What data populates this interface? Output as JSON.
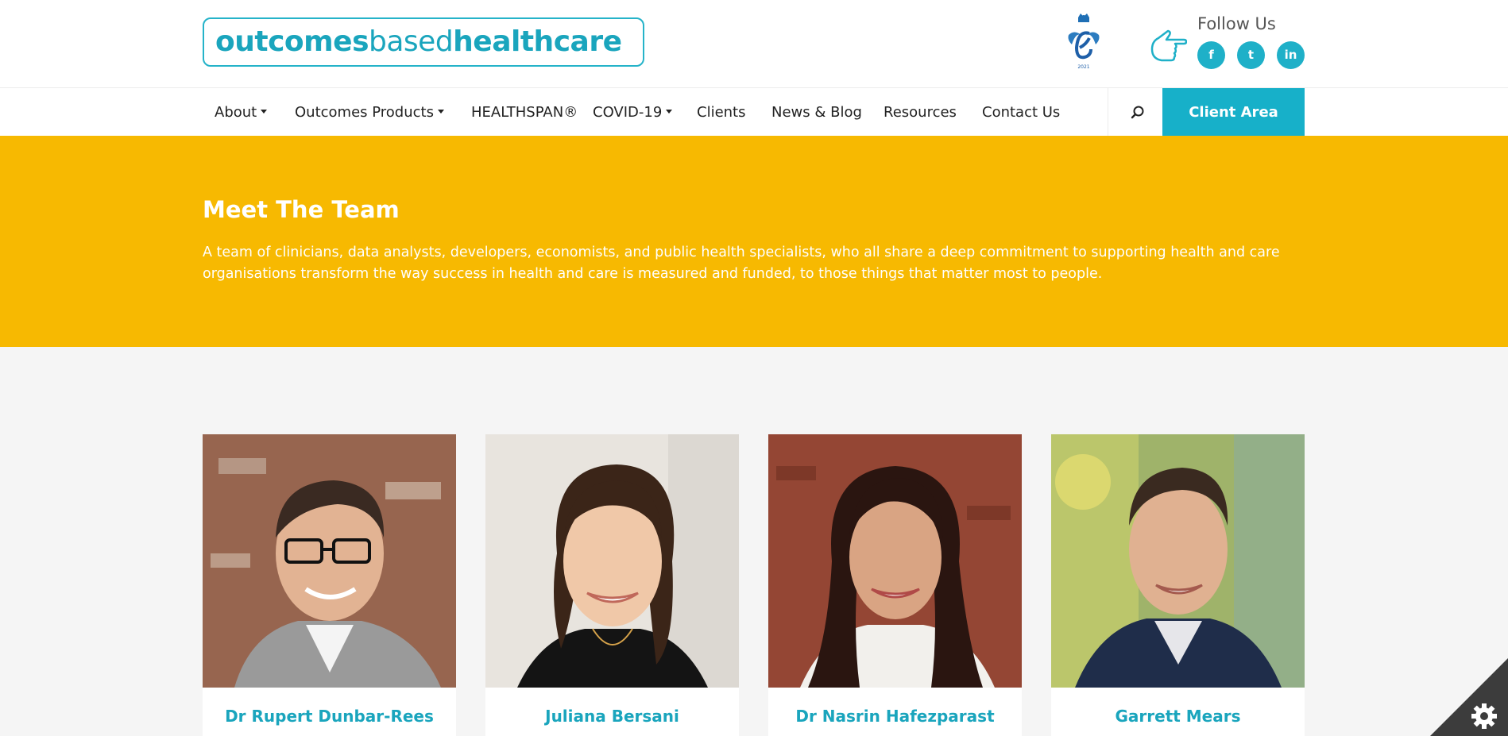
{
  "header": {
    "logo": {
      "part1": "outcomes",
      "part2": "based",
      "part3": "healthcare"
    },
    "award_icon": "queens-award-emblem",
    "follow_label": "Follow Us",
    "social": [
      {
        "icon": "facebook-icon",
        "glyph": "f"
      },
      {
        "icon": "twitter-icon",
        "glyph": "t"
      },
      {
        "icon": "linkedin-icon",
        "glyph": "in"
      }
    ]
  },
  "nav": {
    "items": [
      {
        "label": "About",
        "dropdown": true
      },
      {
        "label": "Outcomes Products",
        "dropdown": true
      },
      {
        "label": "HEALTHSPAN®",
        "dropdown": false
      },
      {
        "label": "COVID-19",
        "dropdown": true
      },
      {
        "label": "Clients",
        "dropdown": false
      },
      {
        "label": "News & Blog",
        "dropdown": false
      },
      {
        "label": "Resources",
        "dropdown": false
      },
      {
        "label": "Contact Us",
        "dropdown": false
      }
    ],
    "search_icon": "search-icon",
    "client_area": "Client Area"
  },
  "hero": {
    "title": "Meet The Team",
    "text": "A team of clinicians, data analysts, developers, economists, and public health specialists, who all share a deep commitment to supporting health and care organisations transform the way success in health and care is measured and funded, to those things that matter most to people."
  },
  "team": [
    {
      "name": "Dr Rupert Dunbar-Rees"
    },
    {
      "name": "Juliana Bersani"
    },
    {
      "name": "Dr Nasrin Hafezparast"
    },
    {
      "name": "Garrett Mears"
    }
  ],
  "colors": {
    "brand": "#1aa5bd",
    "hero": "#f7b901",
    "client_button": "#17b0c9"
  },
  "cookie_icon": "gear-icon"
}
